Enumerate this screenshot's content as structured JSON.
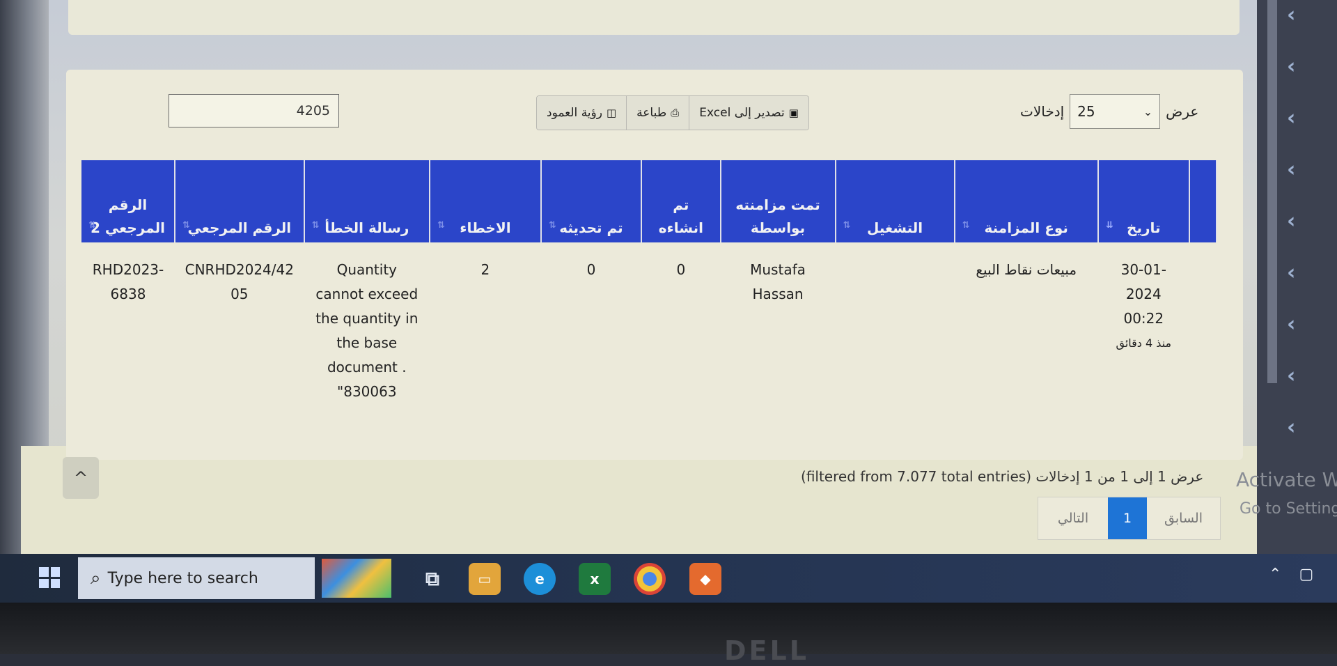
{
  "controls": {
    "search_value": "4205",
    "buttons": {
      "column_visibility": "رؤية العمود",
      "print": "طباعة",
      "export_excel": "تصدير إلى Excel"
    },
    "length": {
      "show": "عرض",
      "value": "25",
      "entries": "إدخالات"
    }
  },
  "table": {
    "headers": {
      "date": "تاريخ",
      "sync_type": "نوع المزامنة",
      "run": "التشغيل",
      "synced_by": "تمت مزامنته بواسطة",
      "created": "تم انشاءه",
      "updated": "تم تحديثه",
      "errors": "الاخطاء",
      "error_message": "رسالة الخطأ",
      "reference": "الرقم المرجعي",
      "reference2": "الرقم المرجعي 2"
    },
    "rows": [
      {
        "date": "30-01-2024 00:22",
        "date_ago": "منذ 4 دقائق",
        "sync_type": "مبيعات نقاط البيع",
        "run": "",
        "synced_by": "Mustafa Hassan",
        "created": "0",
        "updated": "0",
        "errors": "2",
        "error_message": "Quantity cannot exceed the quantity in the base document . \"830063",
        "reference": "CNRHD2024/4205",
        "reference2": "RHD2023-6838"
      }
    ]
  },
  "info": "عرض 1 إلى 1 من 1 إدخالات (filtered from 7.077 total entries)",
  "pagination": {
    "previous": "السابق",
    "current": "1",
    "next": "التالي"
  },
  "watermark": {
    "line1": "Activate W",
    "line2": "Go to Setting"
  },
  "taskbar": {
    "search_placeholder": "Type here to search"
  },
  "bezel_brand": "DELL",
  "colors": {
    "header_blue": "#2b45c9",
    "page_active": "#1e74d6"
  }
}
